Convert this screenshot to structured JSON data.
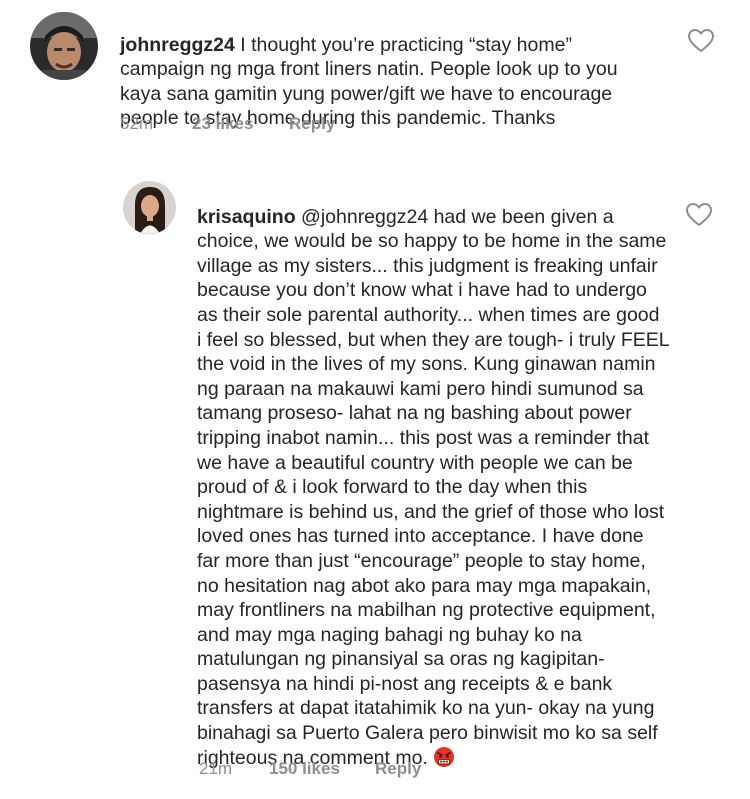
{
  "comments": [
    {
      "username": "johnreggz24",
      "text": " I thought you’re practicing “stay home” campaign ng mga front liners natin. People look up to you kaya sana gamitin yung power/gift we have to encourage people to stay home during this pandemic. Thanks",
      "time": "52m",
      "likes": "23 likes",
      "reply": "Reply",
      "avatar": "male-avatar-with-cap"
    },
    {
      "username": "krisaquino",
      "mention": " @johnreggz24",
      "text": " had we been given a choice, we would be so happy to be home in the same village as my sisters... this judgment is freaking unfair because you don’t know what i have had to undergo as their sole parental authority... when times are good i feel so blessed, but when they are tough- i truly FEEL the void in the lives of my sons. Kung ginawan namin ng paraan na makauwi kami pero hindi sumunod sa tamang proseso- lahat na ng bashing about power tripping inabot namin... this post was a reminder that we have a beautiful country with people we can be proud of & i look forward to the day when this nightmare is behind us, and the grief of those who lost loved ones has turned into acceptance. I have done far more than just “encourage” people to stay home, no hesitation nag abot ako para may mga mapakain, may frontliners na mabilhan ng protective equipment, and may mga naging bahagi ng buhay ko na matulungan ng pinansiyal sa oras ng kagipitan- pasensya na hindi pi-nost ang receipts & e bank transfers at dapat itatahimik ko na yun- okay na yung binahagi sa Puerto Galera pero binwisit mo ko sa self righteous na comment mo. ",
      "emoji": "angry-face-emoji",
      "time": "21m",
      "likes": "150 likes",
      "reply": "Reply",
      "avatar": "female-avatar-portrait"
    }
  ]
}
